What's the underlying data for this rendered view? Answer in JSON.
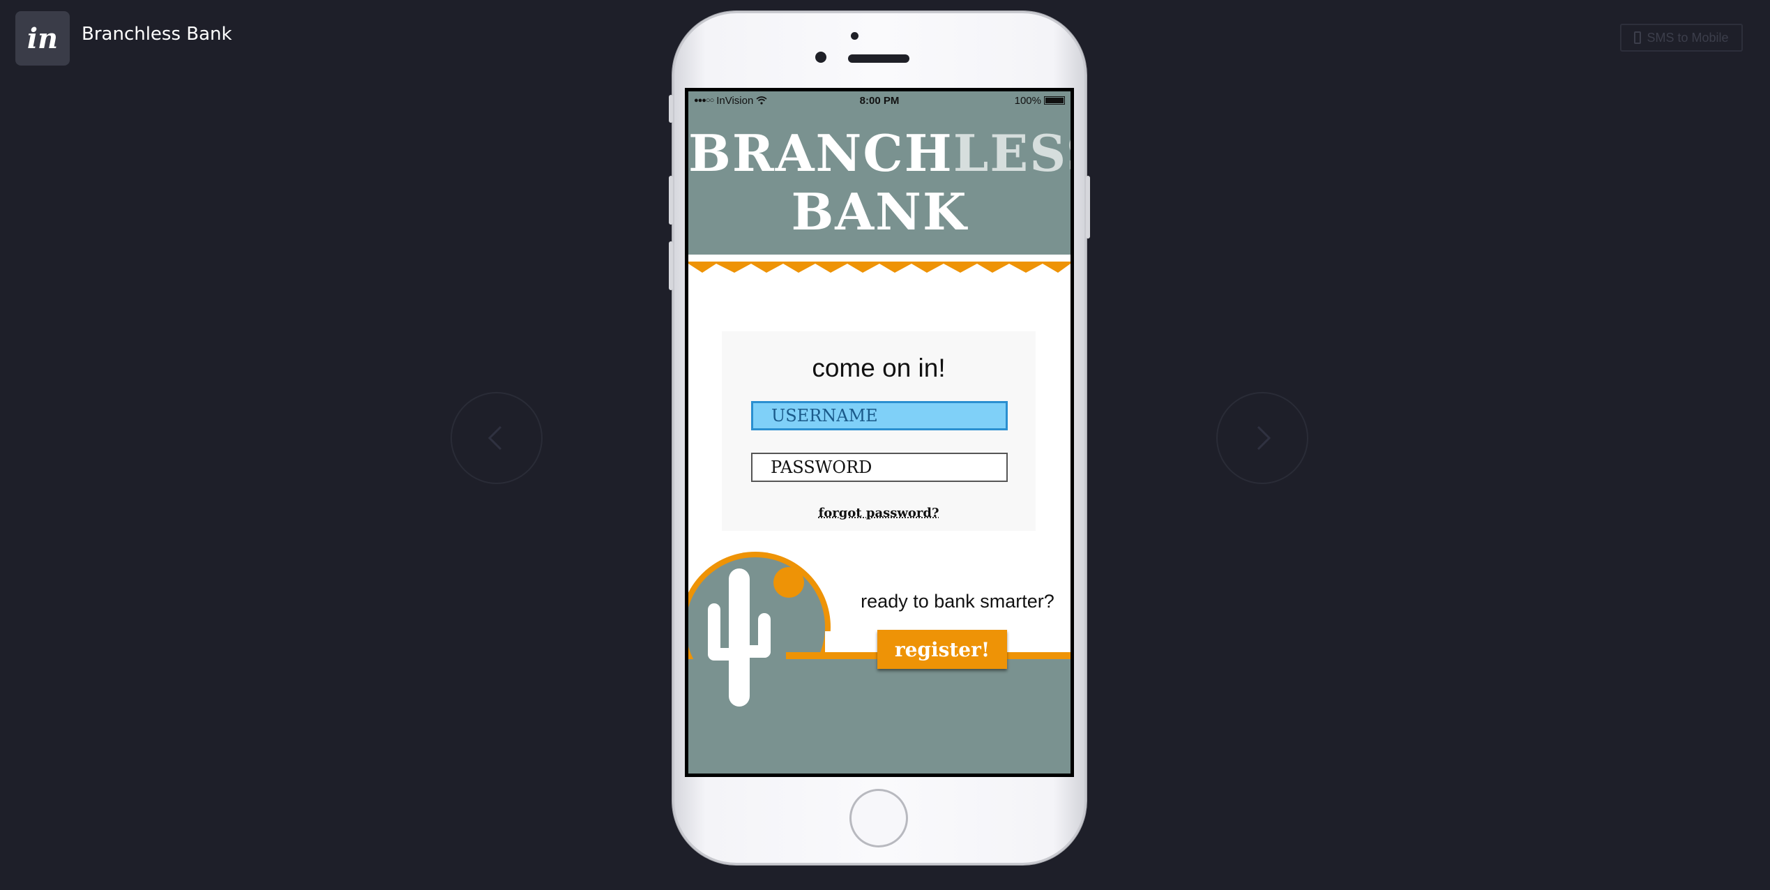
{
  "app": {
    "logo_text": "in",
    "project_title": "Branchless Bank",
    "sms_button": "SMS to Mobile"
  },
  "status_bar": {
    "carrier": "InVision",
    "time": "8:00 PM",
    "battery": "100%"
  },
  "screen": {
    "brand_line1_a": "BRANCH",
    "brand_line1_b": "LESS",
    "brand_line2": "BANK",
    "login_title": "come on in!",
    "username_label": "USERNAME",
    "password_label": "PASSWORD",
    "forgot_link": "forgot password?",
    "cta_text": "ready to bank smarter?",
    "register_button": "register!"
  },
  "colors": {
    "background": "#1e1f29",
    "header_teal": "#7a9290",
    "accent_orange": "#ee9306",
    "username_fill": "#7fd0f8"
  },
  "icons": [
    "invision-logo-icon",
    "phone-icon",
    "chevron-left-icon",
    "chevron-right-icon",
    "wifi-icon",
    "battery-icon",
    "cactus-icon",
    "sun-icon"
  ]
}
